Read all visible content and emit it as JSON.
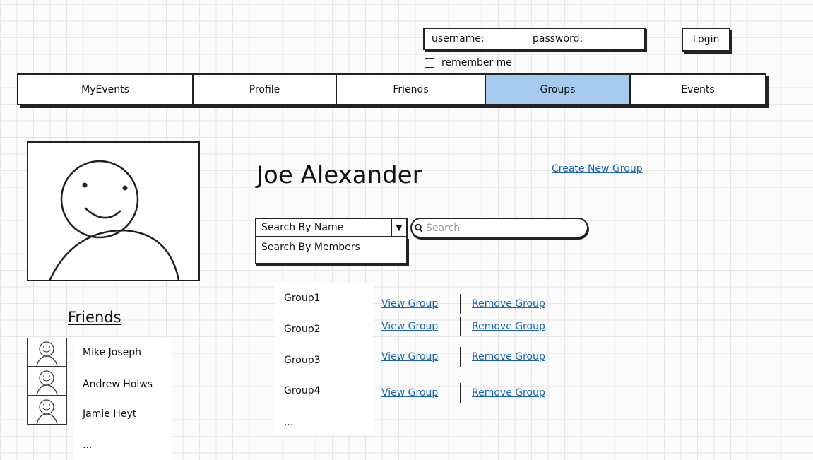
{
  "login": {
    "username_label": "username:",
    "password_label": "password:",
    "login_button": "Login",
    "remember_me": "remember me"
  },
  "nav": {
    "tabs": [
      {
        "label": "MyEvents",
        "active": false
      },
      {
        "label": "Profile",
        "active": false
      },
      {
        "label": "Friends",
        "active": false
      },
      {
        "label": "Groups",
        "active": true
      },
      {
        "label": "Events",
        "active": false
      }
    ]
  },
  "profile": {
    "name": "Joe Alexander",
    "create_group_link": "Create New Group"
  },
  "search": {
    "selected": "Search By Name",
    "option": "Search By Members",
    "placeholder": "Search"
  },
  "friends": {
    "heading": "Friends",
    "items": [
      "Mike Joseph",
      "Andrew Holws",
      "Jamie Heyt"
    ],
    "more": "..."
  },
  "groups": {
    "items": [
      "Group1",
      "Group2",
      "Group3",
      "Group4"
    ],
    "more": "...",
    "view_label": "View Group",
    "remove_label": "Remove Group"
  },
  "colors": {
    "active_tab": "#a6c9ee",
    "link": "#1a62b3"
  }
}
